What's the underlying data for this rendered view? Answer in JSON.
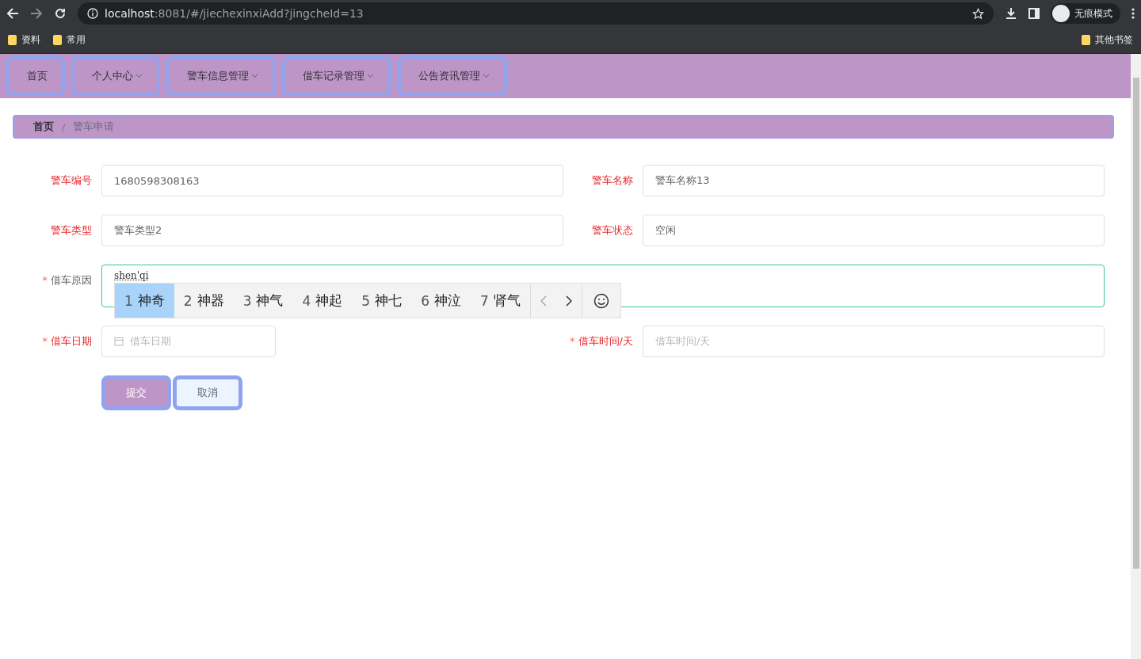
{
  "browser": {
    "url_host": "localhost",
    "url_rest": ":8081/#/jiechexinxiAdd?jingcheId=13",
    "profile": "无痕模式",
    "bookmarks": [
      {
        "label": "资料"
      },
      {
        "label": "常用"
      }
    ],
    "other_bookmarks": "其他书签"
  },
  "nav": [
    {
      "label": "首页",
      "dropdown": false
    },
    {
      "label": "个人中心",
      "dropdown": true
    },
    {
      "label": "警车信息管理",
      "dropdown": true
    },
    {
      "label": "借车记录管理",
      "dropdown": true
    },
    {
      "label": "公告资讯管理",
      "dropdown": true
    }
  ],
  "required_mark": "*",
  "breadcrumb_separator": "/",
  "breadcrumb": [
    {
      "label": "首页",
      "current": false
    },
    {
      "label": "警车申请",
      "current": true
    }
  ],
  "fields": [
    {
      "kind": "text",
      "label": "警车编号",
      "required": false,
      "color": "#e6252b",
      "value": "1680598308163",
      "focused": false
    },
    {
      "kind": "text",
      "label": "警车名称",
      "required": false,
      "color": "#e6252b",
      "value": "警车名称13",
      "focused": false
    },
    {
      "kind": "text",
      "label": "警车类型",
      "required": false,
      "color": "#e6252b",
      "value": "警车类型2",
      "focused": false
    },
    {
      "kind": "text",
      "label": "警车状态",
      "required": false,
      "color": "#e6252b",
      "value": "空闲",
      "focused": false
    },
    {
      "kind": "textarea",
      "label": "借车原因",
      "required": true,
      "color": "#606266",
      "value": "shen'qi",
      "focused": true
    },
    {
      "kind": "date",
      "label": "借车日期",
      "required": true,
      "color": "#e6252b",
      "placeholder": "借车日期",
      "focused": false
    },
    {
      "kind": "text",
      "label": "借车时间/天",
      "required": true,
      "color": "#e6252b",
      "placeholder": "借车时间/天",
      "focused": false
    }
  ],
  "ime": {
    "candidates": [
      {
        "number": "1",
        "text": "神奇",
        "selected": true
      },
      {
        "number": "2",
        "text": "神器",
        "selected": false
      },
      {
        "number": "3",
        "text": "神气",
        "selected": false
      },
      {
        "number": "4",
        "text": "神起",
        "selected": false
      },
      {
        "number": "5",
        "text": "神七",
        "selected": false
      },
      {
        "number": "6",
        "text": "神泣",
        "selected": false
      },
      {
        "number": "7",
        "text": "肾气",
        "selected": false
      }
    ]
  },
  "buttons": [
    {
      "kind": "primary",
      "label": "提交"
    },
    {
      "kind": "default",
      "label": "取消"
    }
  ]
}
